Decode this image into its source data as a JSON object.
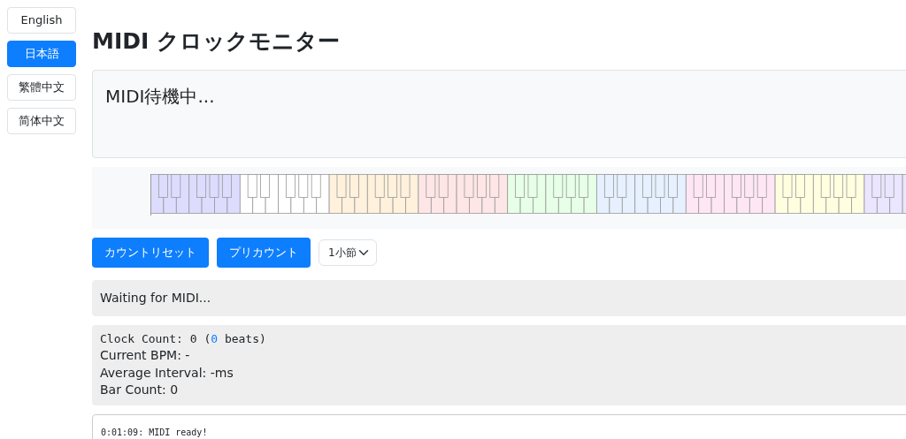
{
  "languages": [
    {
      "label": "English",
      "selected": false
    },
    {
      "label": "日本語",
      "selected": true
    },
    {
      "label": "繁體中文",
      "selected": false
    },
    {
      "label": "简体中文",
      "selected": false
    }
  ],
  "title": "MIDI クロックモニター",
  "status_display": "MIDI待機中...",
  "buttons": [
    "カウントリセット",
    "プリカウント"
  ],
  "precount_select": {
    "value": "1小節"
  },
  "message": "Waiting for MIDI...",
  "stats": {
    "clock_count": {
      "before": "Clock Count: 0 (",
      "beats": "0",
      "after": " beats)"
    },
    "lines": [
      "Current BPM: -",
      "Average Interval: -ms",
      "Bar Count: 0"
    ]
  },
  "log": [
    "0:01:09: MIDI ready!"
  ]
}
